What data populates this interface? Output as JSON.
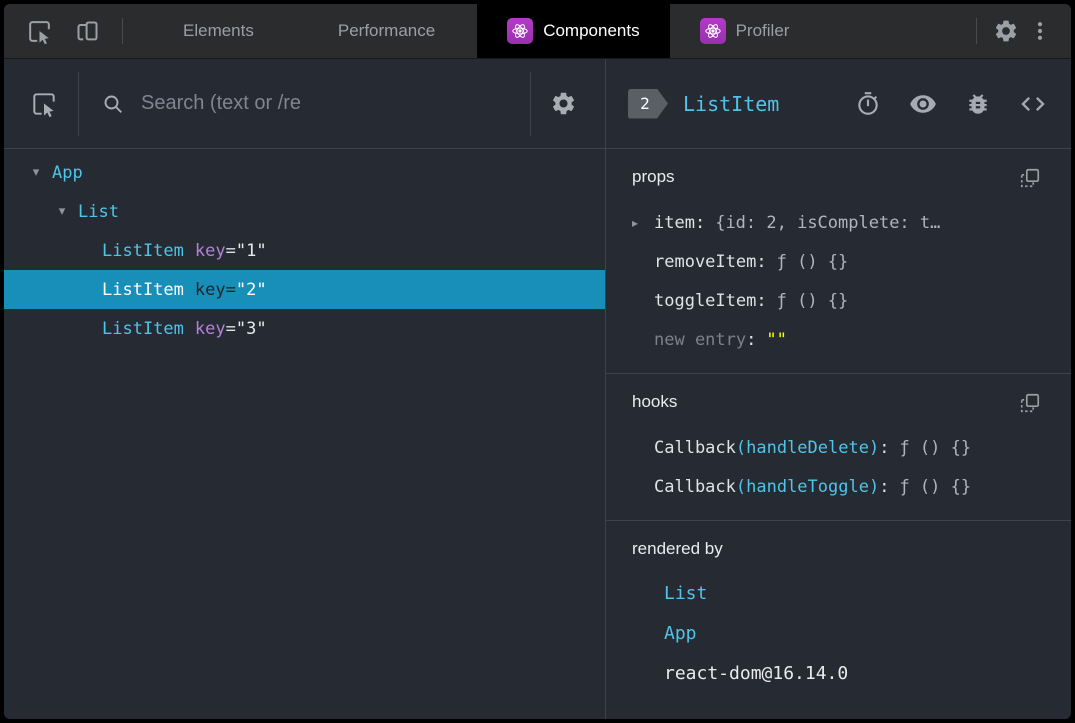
{
  "topbar": {
    "tabs": [
      {
        "label": "Elements"
      },
      {
        "label": "Performance"
      },
      {
        "label": "Components"
      },
      {
        "label": "Profiler"
      }
    ]
  },
  "left_panel": {
    "search_placeholder": "Search (text or /re",
    "attr_equals": "=",
    "tree": [
      {
        "label": "App"
      },
      {
        "label": "List"
      },
      {
        "label": "ListItem",
        "key_name": "key",
        "key_value": "\"1\""
      },
      {
        "label": "ListItem",
        "key_name": "key",
        "key_value": "\"2\"",
        "selected": true
      },
      {
        "label": "ListItem",
        "key_name": "key",
        "key_value": "\"3\""
      }
    ]
  },
  "right_panel": {
    "badge": "2",
    "component_name": "ListItem",
    "props": {
      "title": "props",
      "rows": [
        {
          "name": "item",
          "value": "{id: 2, isComplete: t…"
        },
        {
          "name": "removeItem",
          "value": "ƒ () {}"
        },
        {
          "name": "toggleItem",
          "value": "ƒ () {}"
        },
        {
          "name": "new entry",
          "value": "\"\""
        }
      ]
    },
    "hooks": {
      "title": "hooks",
      "rows": [
        {
          "name": "Callback",
          "paren": "(handleDelete)",
          "value": "ƒ () {}"
        },
        {
          "name": "Callback",
          "paren": "(handleToggle)",
          "value": "ƒ () {}"
        }
      ]
    },
    "rendered_by": {
      "title": "rendered by",
      "items": [
        "List",
        "App",
        "react-dom@16.14.0"
      ]
    }
  },
  "punct": {
    "colon": ":"
  },
  "icons": {
    "expander_down": "▾",
    "expander_right": "▸"
  },
  "colors": {
    "selection_background": "#178fb9",
    "component_name_cyan": "#4fc4e8",
    "attribute_purple": "#b481d9",
    "react_icon_magenta": "#a936bd",
    "editable_value_yellow": "#ffff00",
    "panel_background": "#262b33",
    "topbar_background": "#2b2c2e",
    "active_tab_background": "#000000"
  }
}
